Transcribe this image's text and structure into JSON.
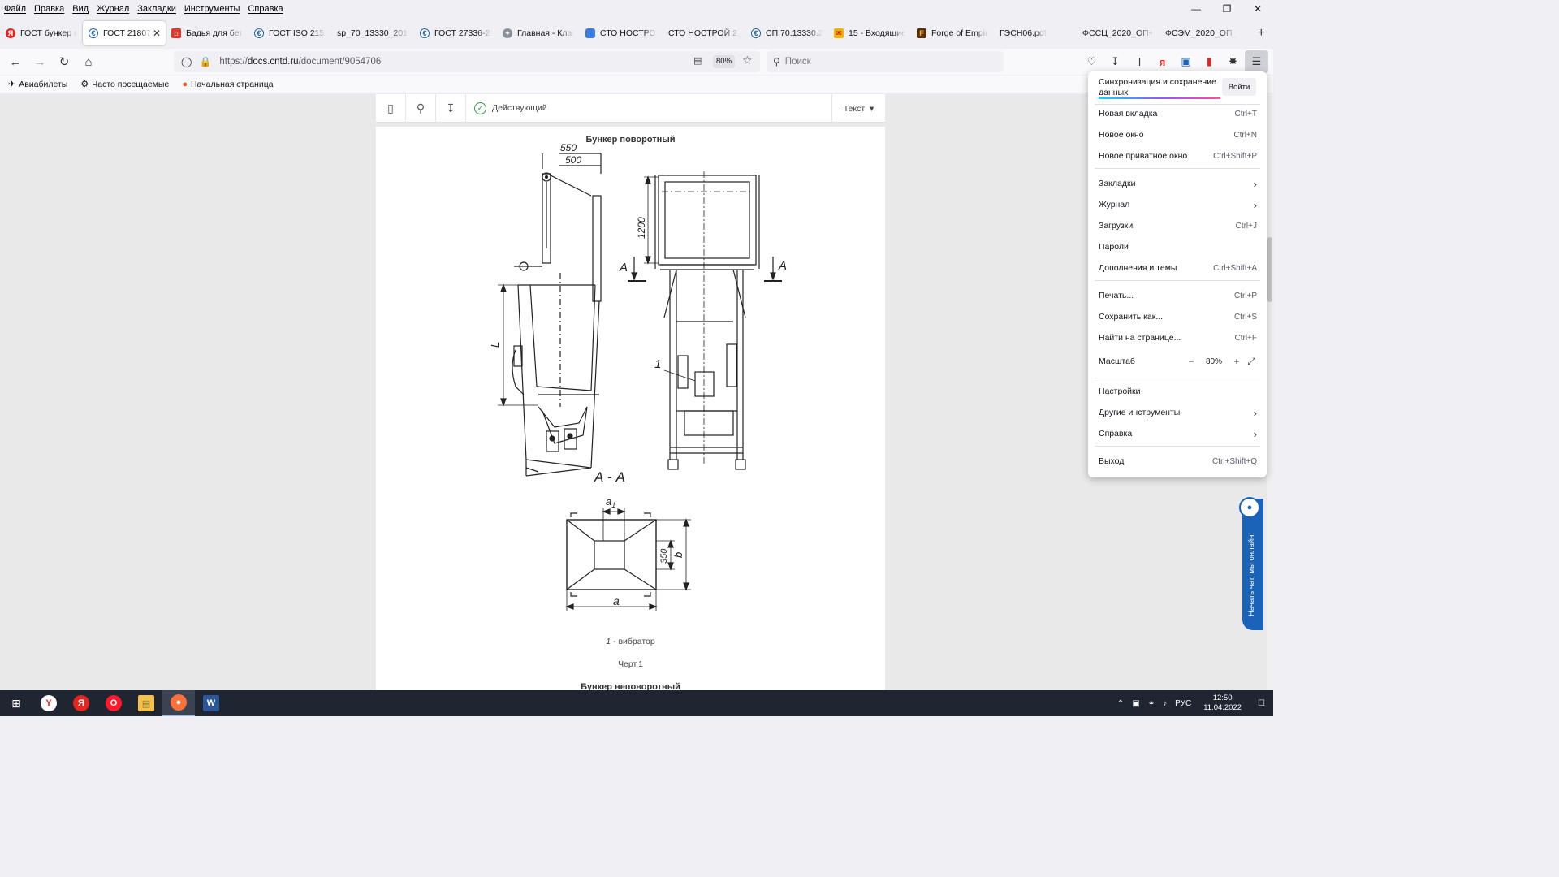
{
  "menubar": [
    "Файл",
    "Правка",
    "Вид",
    "Журнал",
    "Закладки",
    "Инструменты",
    "Справка"
  ],
  "tabs": [
    {
      "label": "ГОСТ бункер я",
      "icon": "yandex-icon",
      "color": "#e52620",
      "glyph": "Я"
    },
    {
      "label": "ГОСТ 21807-",
      "icon": "cntd-icon",
      "color": "#1a63b8",
      "glyph": "€",
      "active": true
    },
    {
      "label": "Бадья для бето",
      "icon": "house-icon",
      "color": "#e0382e",
      "glyph": "⌂"
    },
    {
      "label": "ГОСТ ISO 2157",
      "icon": "cntd-icon",
      "color": "#1a63b8",
      "glyph": "€"
    },
    {
      "label": "sp_70_13330_2012.p",
      "icon": "",
      "color": "",
      "glyph": ""
    },
    {
      "label": "ГОСТ 27336-20",
      "icon": "cntd-icon",
      "color": "#1a63b8",
      "glyph": "€"
    },
    {
      "label": "Главная - Клас",
      "icon": "emblem-icon",
      "color": "#8a8f99",
      "glyph": "✦"
    },
    {
      "label": "СТО НОСТРОЙ",
      "icon": "nostroy-icon",
      "color": "#3a7be0",
      "glyph": "■"
    },
    {
      "label": "СТО НОСТРОЙ 2.6",
      "icon": "",
      "color": "",
      "glyph": ""
    },
    {
      "label": "СП 70.13330.20",
      "icon": "cntd-icon",
      "color": "#1a63b8",
      "glyph": "€"
    },
    {
      "label": "15 - Входящие",
      "icon": "mail-icon",
      "color": "#f0b400",
      "glyph": "✉"
    },
    {
      "label": "Forge of Empire",
      "icon": "forge-icon",
      "color": "#5a2d0c",
      "glyph": "F"
    },
    {
      "label": "ГЭСН06.pdf",
      "icon": "",
      "color": "",
      "glyph": ""
    },
    {
      "label": "ФССЦ_2020_ОП+М",
      "icon": "",
      "color": "",
      "glyph": ""
    },
    {
      "label": "ФСЭМ_2020_ОП_М",
      "icon": "",
      "color": "",
      "glyph": ""
    }
  ],
  "nav": {
    "url_prefix": "https://",
    "url_domain": "docs.cntd.ru",
    "url_path": "/document/9054706",
    "zoom": "80%",
    "search_placeholder": "Поиск"
  },
  "bookmarks": [
    {
      "label": "Авиабилеты",
      "icon": "plane-icon",
      "glyph": "✈"
    },
    {
      "label": "Часто посещаемые",
      "icon": "gear-icon",
      "glyph": "⚙"
    },
    {
      "label": "Начальная страница",
      "icon": "firefox-icon",
      "glyph": "●"
    }
  ],
  "doc": {
    "status": "Действующий",
    "view_mode": "Текст",
    "title": "Бункер поворотный",
    "section_label": "А - А",
    "legend_num": "1",
    "legend_text": " - вибратор",
    "figure_caption": "Черт.1",
    "next_title": "Бункер неповоротный",
    "dims": {
      "d550": "550",
      "d500": "500",
      "d1200": "1200",
      "L": "L",
      "A": "А",
      "one": "1",
      "a1": "a",
      "a1sub": "1",
      "d350": "350",
      "b": "b",
      "a": "a"
    }
  },
  "app_menu": {
    "sync": "Синхронизация и сохранение данных",
    "login": "Войти",
    "items": [
      {
        "label": "Новая вкладка",
        "shortcut": "Ctrl+T"
      },
      {
        "label": "Новое окно",
        "shortcut": "Ctrl+N"
      },
      {
        "label": "Новое приватное окно",
        "shortcut": "Ctrl+Shift+P"
      },
      {
        "label": "Закладки",
        "shortcut": ""
      },
      {
        "label": "Журнал",
        "shortcut": ""
      },
      {
        "label": "Загрузки",
        "shortcut": "Ctrl+J"
      },
      {
        "label": "Пароли",
        "shortcut": ""
      },
      {
        "label": "Дополнения и темы",
        "shortcut": "Ctrl+Shift+A"
      },
      {
        "label": "Печать...",
        "shortcut": "Ctrl+P"
      },
      {
        "label": "Сохранить как...",
        "shortcut": "Ctrl+S"
      },
      {
        "label": "Найти на странице...",
        "shortcut": "Ctrl+F"
      },
      {
        "label": "Настройки",
        "shortcut": ""
      },
      {
        "label": "Другие инструменты",
        "shortcut": ""
      },
      {
        "label": "Справка",
        "shortcut": ""
      },
      {
        "label": "Выход",
        "shortcut": "Ctrl+Shift+Q"
      }
    ],
    "zoom_label": "Масштаб",
    "zoom_value": "80%"
  },
  "chat": "Начать чат, мы онлайн!",
  "taskbar": {
    "lang": "РУС",
    "time": "12:50",
    "date": "11.04.2022"
  }
}
